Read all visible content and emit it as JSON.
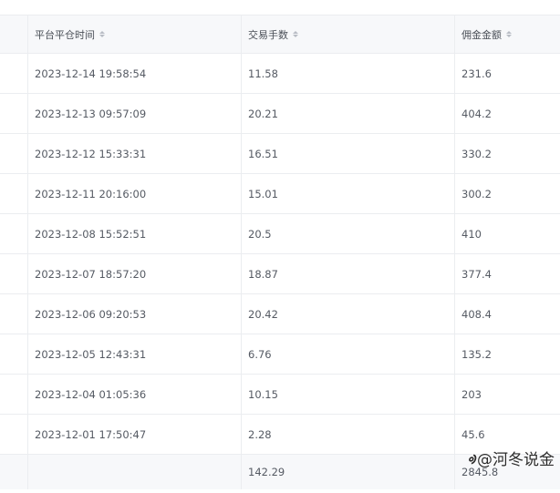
{
  "columns": [
    {
      "label": "平台平仓时间"
    },
    {
      "label": "交易手数"
    },
    {
      "label": "佣金金额"
    }
  ],
  "rows": [
    {
      "time": "2023-12-14 19:58:54",
      "lots": "11.58",
      "commission": "231.6"
    },
    {
      "time": "2023-12-13 09:57:09",
      "lots": "20.21",
      "commission": "404.2"
    },
    {
      "time": "2023-12-12 15:33:31",
      "lots": "16.51",
      "commission": "330.2"
    },
    {
      "time": "2023-12-11 20:16:00",
      "lots": "15.01",
      "commission": "300.2"
    },
    {
      "time": "2023-12-08 15:52:51",
      "lots": "20.5",
      "commission": "410"
    },
    {
      "time": "2023-12-07 18:57:20",
      "lots": "18.87",
      "commission": "377.4"
    },
    {
      "time": "2023-12-06 09:20:53",
      "lots": "20.42",
      "commission": "408.4"
    },
    {
      "time": "2023-12-05 12:43:31",
      "lots": "6.76",
      "commission": "135.2"
    },
    {
      "time": "2023-12-04 01:05:36",
      "lots": "10.15",
      "commission": "203"
    },
    {
      "time": "2023-12-01 17:50:47",
      "lots": "2.28",
      "commission": "45.6"
    }
  ],
  "summary": {
    "lots": "142.29",
    "commission": "2845.8"
  },
  "watermark": {
    "text": "@河冬说金",
    "logo": "ᢀ"
  }
}
